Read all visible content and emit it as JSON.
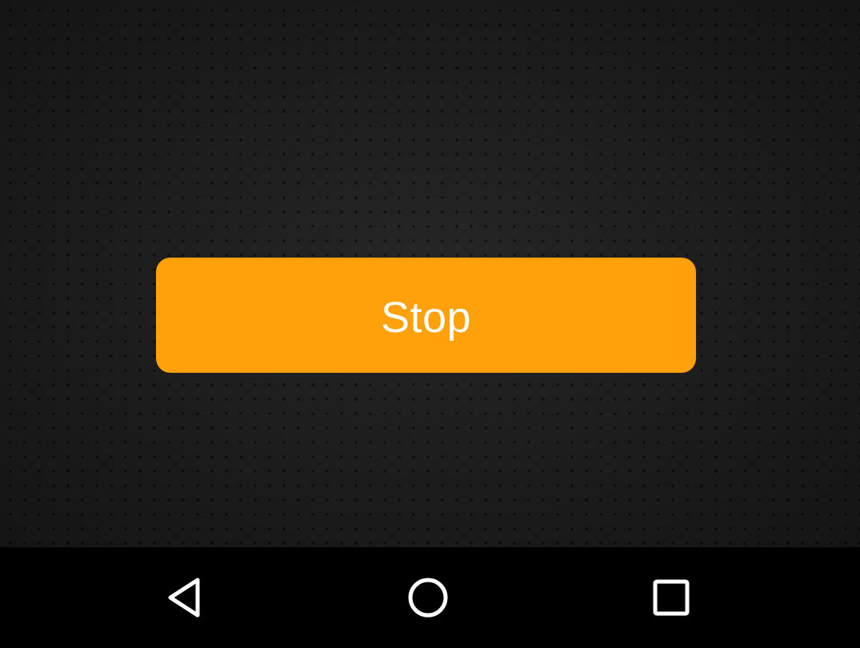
{
  "main": {
    "stop_label": "Stop",
    "button_color": "#ffa10a",
    "background_color": "#1f1f1f"
  },
  "nav_bar": {
    "icons": [
      "back-triangle-icon",
      "home-circle-icon",
      "recents-square-icon"
    ]
  }
}
